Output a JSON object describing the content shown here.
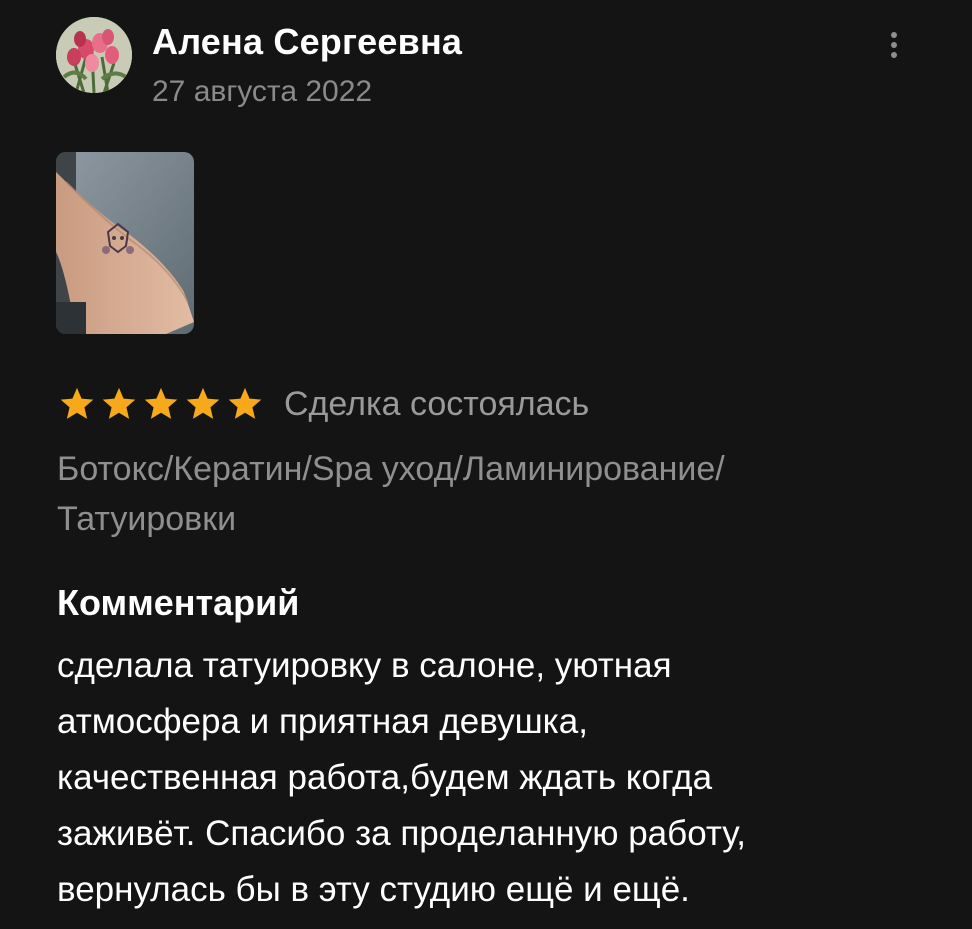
{
  "review": {
    "author": {
      "name": "Алена Сергеевна",
      "avatar_icon": "tulips-avatar-photo"
    },
    "date": "27 августа 2022",
    "menu_icon": "more-vertical-icon",
    "photo": {
      "description_icon": "tattoo-forearm-photo"
    },
    "rating": {
      "stars": 5,
      "max_stars": 5,
      "star_color": "#f7a81b",
      "star_icon": "star-icon"
    },
    "deal_status": "Сделка состоялась",
    "category_lines": [
      "Ботокс/Кератин/Spa уход/Ламинирование/",
      "Татуировки"
    ],
    "comment_heading": "Комментарий",
    "comment_lines": [
      "сделала татуировку в салоне, уютная",
      "атмосфера и приятная девушка,",
      "качественная работа,будем ждать когда",
      "заживёт. Спасибо за проделанную работу,",
      "вернулась бы в эту студию ещё и ещё."
    ]
  },
  "colors": {
    "background": "#141414",
    "primary_text": "#ffffff",
    "secondary_text": "#8a8a8a",
    "star": "#f7a81b"
  }
}
